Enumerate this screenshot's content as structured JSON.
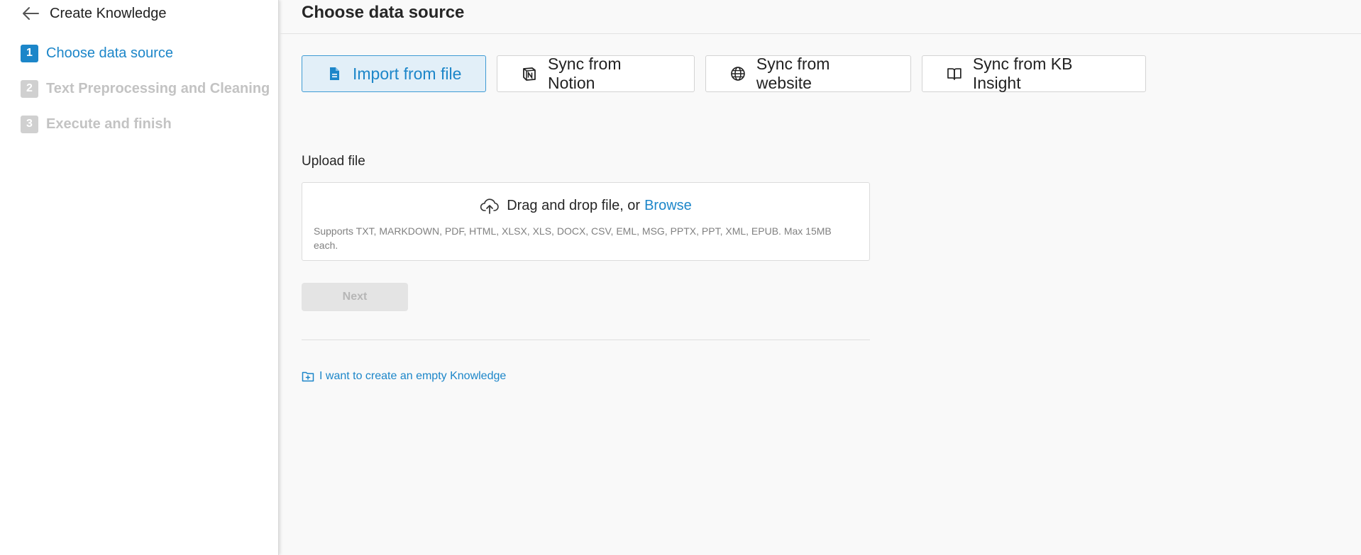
{
  "sidebar": {
    "back_title": "Create Knowledge",
    "steps": [
      {
        "number": "1",
        "label": "Choose data source",
        "state": "active"
      },
      {
        "number": "2",
        "label": "Text Preprocessing and Cleaning",
        "state": "inactive"
      },
      {
        "number": "3",
        "label": "Execute and finish",
        "state": "inactive"
      }
    ]
  },
  "header": {
    "title": "Choose data source"
  },
  "sources": [
    {
      "label": "Import from file",
      "icon": "file-icon",
      "selected": true
    },
    {
      "label": "Sync from Notion",
      "icon": "notion-icon",
      "selected": false
    },
    {
      "label": "Sync from website",
      "icon": "globe-icon",
      "selected": false
    },
    {
      "label": "Sync from KB Insight",
      "icon": "book-icon",
      "selected": false
    }
  ],
  "upload": {
    "label": "Upload file",
    "drag_text": "Drag and drop file, or",
    "browse_text": "Browse",
    "hint": "Supports TXT, MARKDOWN, PDF, HTML, XLSX, XLS, DOCX, CSV, EML, MSG, PPTX, PPT, XML, EPUB. Max 15MB each."
  },
  "next_label": "Next",
  "empty_link": "I want to create an empty Knowledge",
  "colors": {
    "accent": "#1c86c9",
    "selected_bg": "#e2eff8",
    "inactive_step": "#c3c3c3",
    "background": "#f9f9f9"
  }
}
